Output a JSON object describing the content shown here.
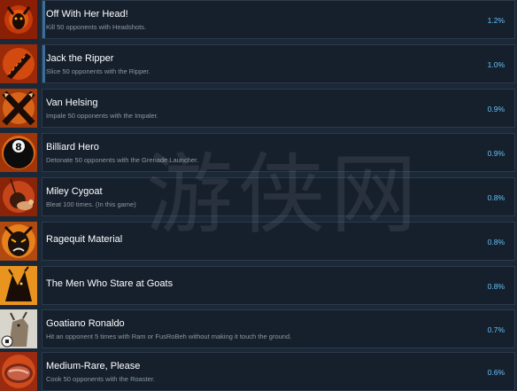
{
  "achievements": [
    {
      "title": "Off With Her Head!",
      "desc": "Kill 50 opponents with Headshots.",
      "pct": "1.2%",
      "icon": "goat-head-target-icon",
      "progress": 0.02
    },
    {
      "title": "Jack the Ripper",
      "desc": "Slice 50 opponents with the Ripper.",
      "pct": "1.0%",
      "icon": "ripper-blade-icon",
      "progress": 0.01
    },
    {
      "title": "Van Helsing",
      "desc": "Impale 50 opponents with the Impaler.",
      "pct": "0.9%",
      "icon": "crossed-stakes-icon",
      "progress": 0
    },
    {
      "title": "Billiard Hero",
      "desc": "Detonate 50 opponents with the Grenade Launcher.",
      "pct": "0.9%",
      "icon": "eight-ball-icon",
      "ball_label": "8",
      "progress": 0
    },
    {
      "title": "Miley Cygoat",
      "desc": "Bleat 100 times. (In this game)",
      "pct": "0.8%",
      "icon": "wrecking-ball-goat-icon",
      "progress": 0
    },
    {
      "title": "Ragequit Material",
      "desc": "",
      "pct": "0.8%",
      "icon": "angry-goat-face-icon",
      "progress": 0
    },
    {
      "title": "The Men Who Stare at Goats",
      "desc": "",
      "pct": "0.8%",
      "icon": "staring-goat-silhouette-icon",
      "progress": 0
    },
    {
      "title": "Goatiano Ronaldo",
      "desc": "Hit an opponent 5 times with Ram or FusRoBeh without making it touch the ground.",
      "pct": "0.7%",
      "icon": "soccer-goat-icon",
      "progress": 0
    },
    {
      "title": "Medium-Rare, Please",
      "desc": "Cook 50 opponents with the Roaster.",
      "pct": "0.6%",
      "icon": "steak-icon",
      "progress": 0
    }
  ],
  "watermark": "游侠网",
  "colors": {
    "background": "#1b2838",
    "panel": "#16202d",
    "border": "#2c3a4b",
    "title": "#ffffff",
    "desc": "#8f98a0",
    "percent": "#66c0f4",
    "progress": "#3a6f9c"
  }
}
